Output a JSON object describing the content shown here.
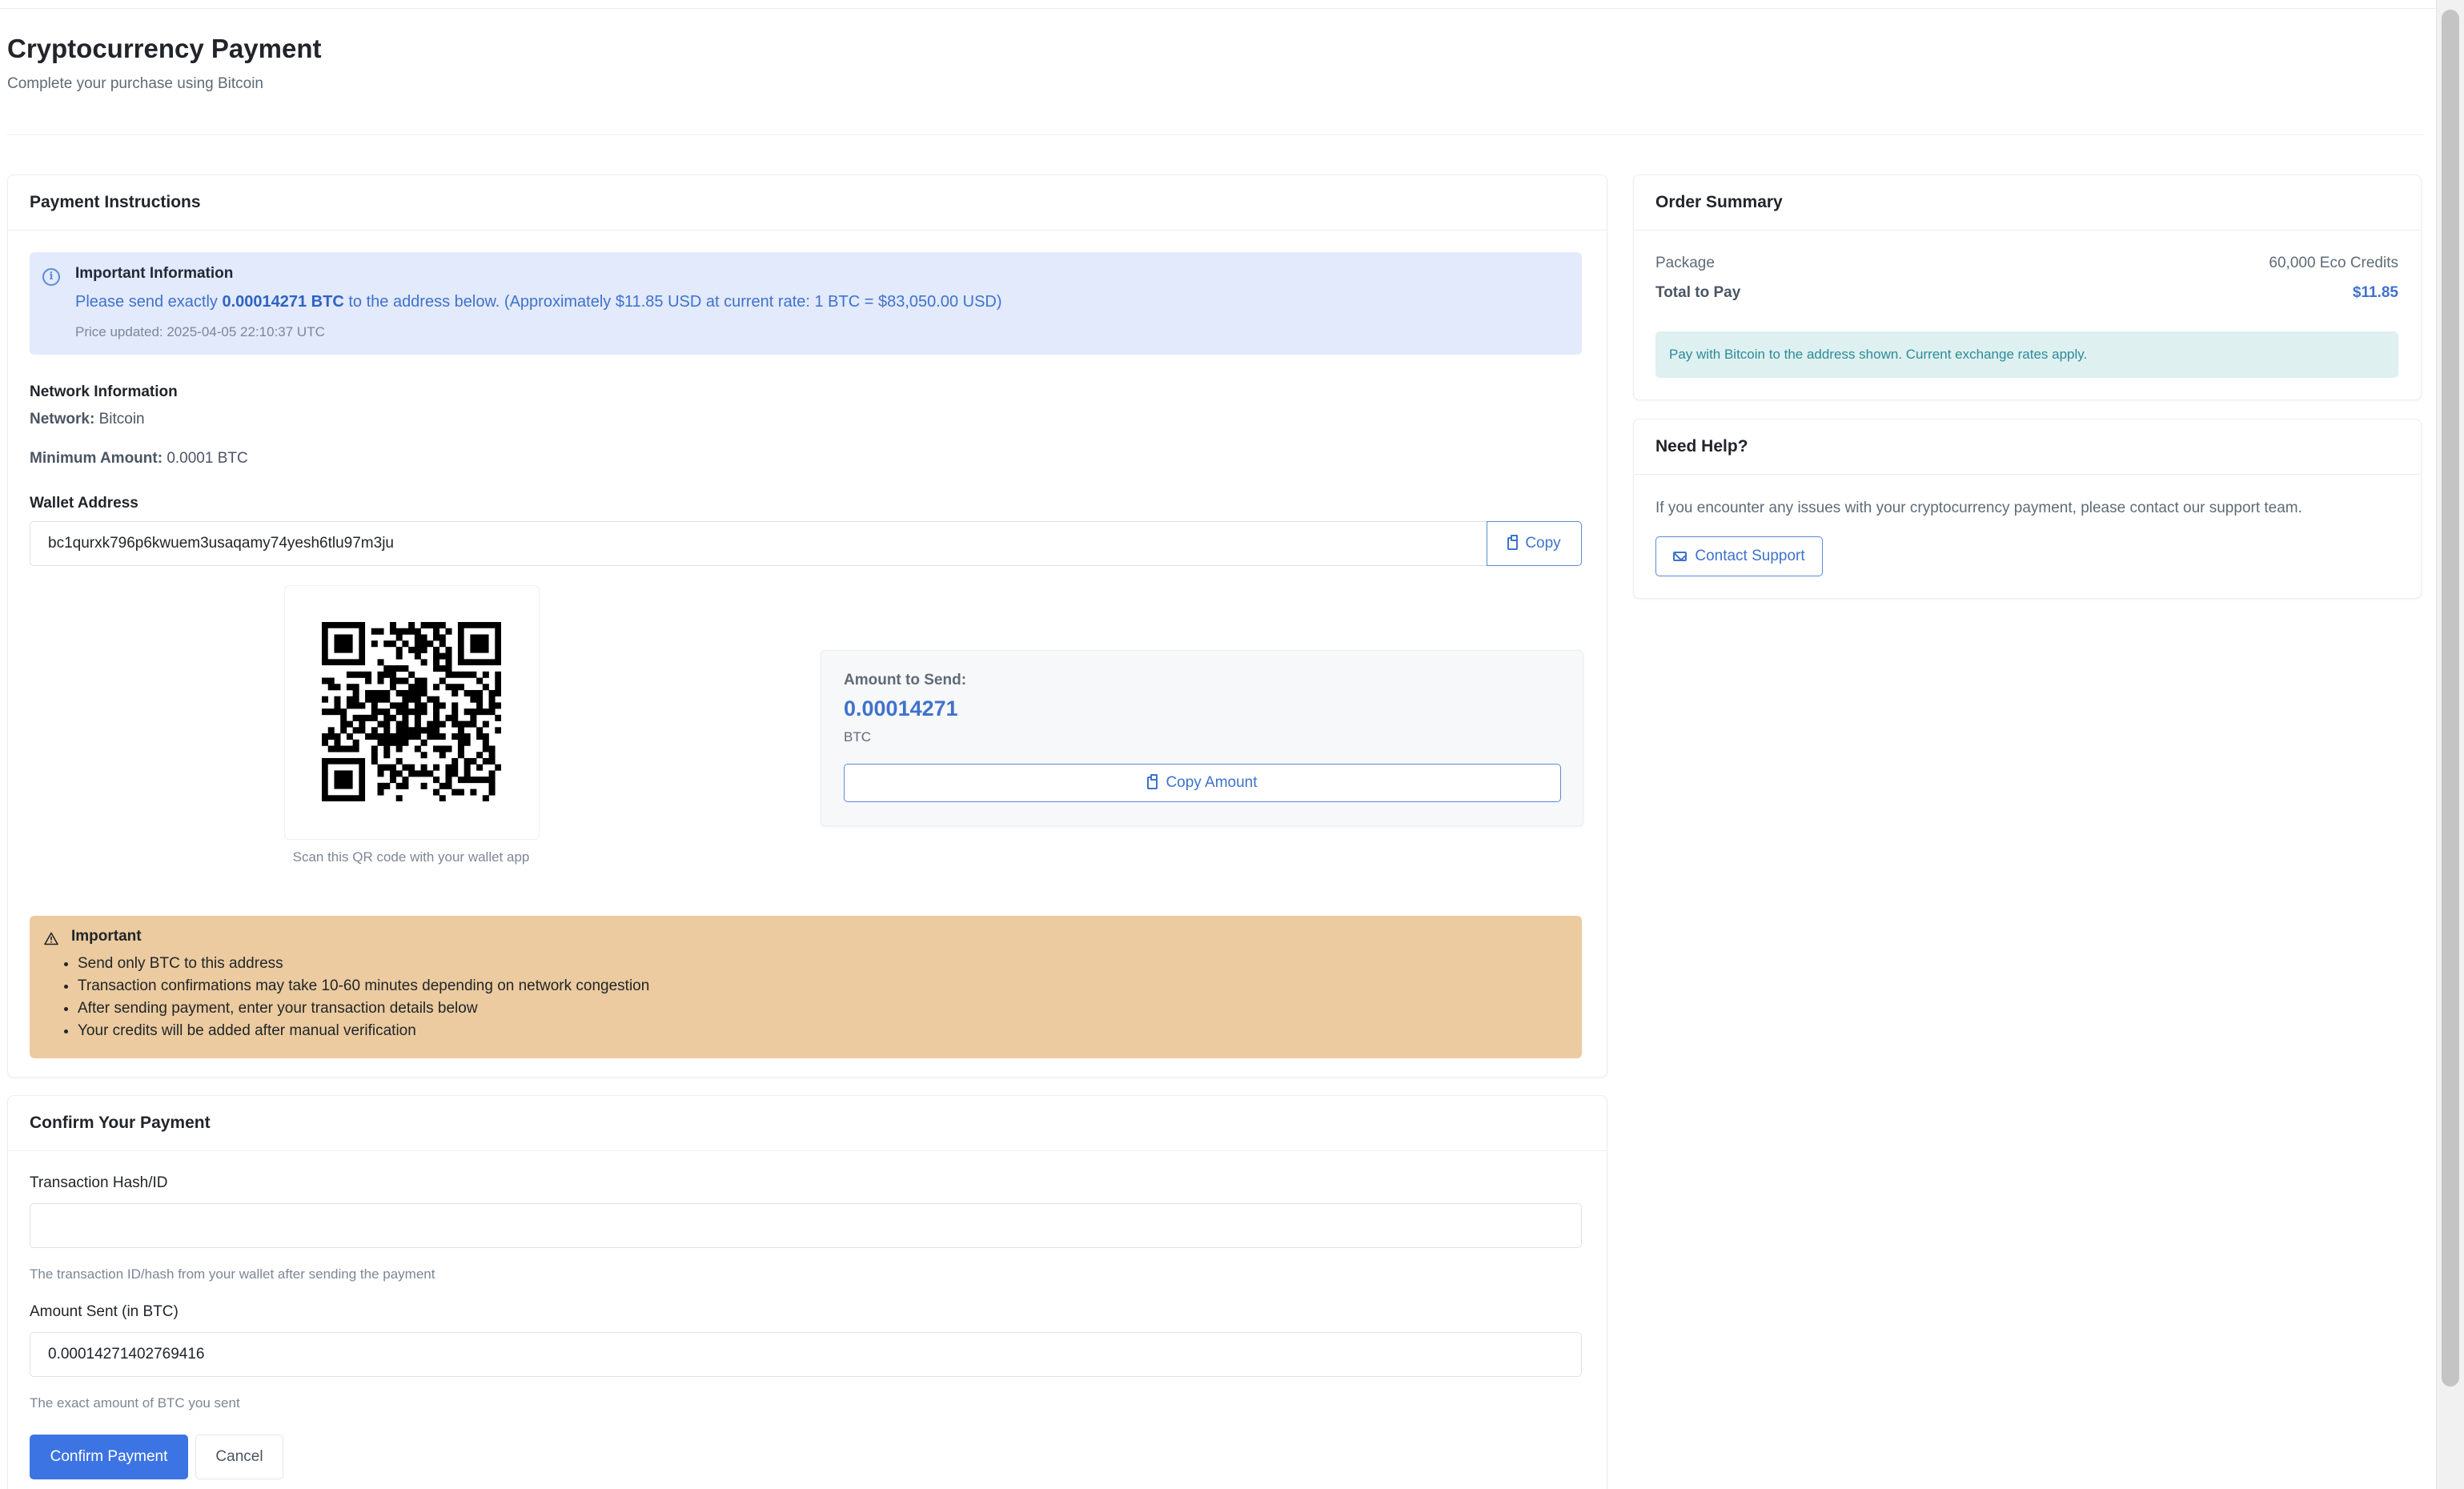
{
  "header": {
    "title": "Cryptocurrency Payment",
    "subtitle": "Complete your purchase using Bitcoin"
  },
  "instructions": {
    "title": "Payment Instructions",
    "info": {
      "icon": "info-circle-icon",
      "heading": "Important Information",
      "text_prefix": "Please send exactly",
      "text_amount": "0.00014271 BTC",
      "text_suffix": "to the address below. (Approximately $11.85 USD at current rate: 1 BTC = $83,050.00 USD)",
      "updated": "Price updated: 2025-04-05 22:10:37 UTC"
    },
    "network": {
      "heading": "Network Information",
      "network_label": "Network:",
      "network_value": "Bitcoin",
      "min_label": "Minimum Amount:",
      "min_value": "0.0001 BTC"
    },
    "wallet": {
      "label": "Wallet Address",
      "address": "bc1qurxk796p6kwuem3usaqamy74yesh6tlu97m3ju",
      "copy_label": "Copy",
      "copy_icon": "clipboard-icon"
    },
    "qr_caption": "Scan this QR code with your wallet app",
    "amount": {
      "label": "Amount to Send:",
      "value": "0.00014271",
      "unit": "BTC",
      "copy_label": "Copy Amount"
    },
    "warning": {
      "icon": "warning-triangle-icon",
      "heading": "Important",
      "items": [
        "Send only BTC to this address",
        "Transaction confirmations may take 10-60 minutes depending on network congestion",
        "After sending payment, enter your transaction details below",
        "Your credits will be added after manual verification"
      ],
      "bg_color": "#ebcb9f"
    }
  },
  "confirm": {
    "title": "Confirm Your Payment",
    "tx_label": "Transaction Hash/ID",
    "tx_value": "",
    "tx_help": "The transaction ID/hash from your wallet after sending the payment",
    "amount_label": "Amount Sent (in BTC)",
    "amount_value": "0.00014271402769416",
    "amount_help": "The exact amount of BTC you sent",
    "submit_label": "Confirm Payment",
    "cancel_label": "Cancel"
  },
  "summary": {
    "title": "Order Summary",
    "package_label": "Package",
    "package_value": "60,000 Eco Credits",
    "total_label": "Total to Pay",
    "total_value": "$11.85",
    "note": "Pay with Bitcoin to the address shown. Current exchange rates apply."
  },
  "help": {
    "title": "Need Help?",
    "text": "If you encounter any issues with your cryptocurrency payment, please contact our support team.",
    "contact_label": "Contact Support",
    "contact_icon": "envelope-icon"
  },
  "colors": {
    "accent": "#3d74e3",
    "link": "#3f72cc",
    "info_bg": "#e2eafb",
    "note_bg": "#def0f0"
  }
}
